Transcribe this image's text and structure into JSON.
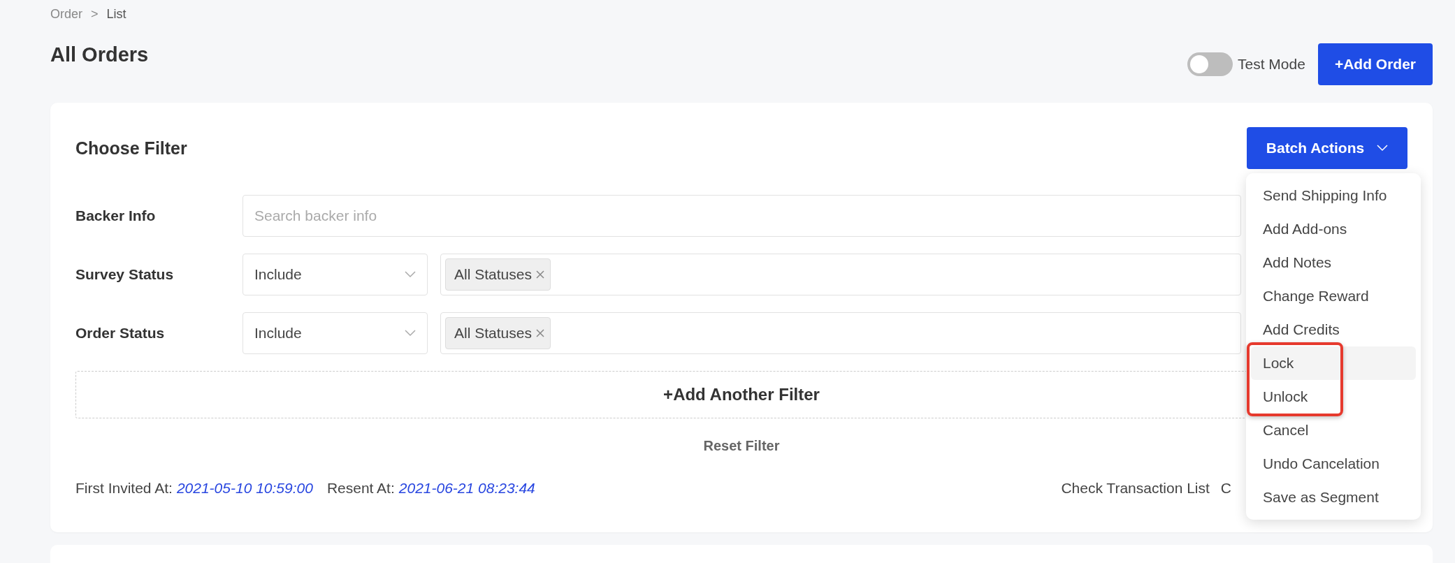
{
  "breadcrumb": {
    "items": [
      "Order",
      "List"
    ],
    "separator": ">"
  },
  "page_title": "All Orders",
  "test_mode": {
    "label": "Test Mode",
    "on": false
  },
  "add_order_button": "+Add Order",
  "filter_card": {
    "title": "Choose Filter",
    "batch_button": "Batch Actions",
    "filters": [
      {
        "kind": "search",
        "label": "Backer Info",
        "placeholder": "Search backer info"
      },
      {
        "kind": "status",
        "label": "Survey Status",
        "mode": "Include",
        "tags": [
          "All Statuses"
        ]
      },
      {
        "kind": "status",
        "label": "Order Status",
        "mode": "Include",
        "tags": [
          "All Statuses"
        ]
      }
    ],
    "add_filter": "+Add Another Filter",
    "reset": "Reset Filter",
    "dates": [
      {
        "label": "First Invited At:",
        "value": "2021-05-10 10:59:00"
      },
      {
        "label": "Resent At:",
        "value": "2021-06-21 08:23:44"
      }
    ],
    "links": [
      "Check Transaction List",
      "C"
    ]
  },
  "batch_menu": {
    "items": [
      {
        "label": "Send Shipping Info",
        "hovered": false,
        "annotated": false
      },
      {
        "label": "Add Add-ons",
        "hovered": false,
        "annotated": false
      },
      {
        "label": "Add Notes",
        "hovered": false,
        "annotated": false
      },
      {
        "label": "Change Reward",
        "hovered": false,
        "annotated": false
      },
      {
        "label": "Add Credits",
        "hovered": false,
        "annotated": false
      },
      {
        "label": "Lock",
        "hovered": true,
        "annotated": true
      },
      {
        "label": "Unlock",
        "hovered": false,
        "annotated": true
      },
      {
        "label": "Cancel",
        "hovered": false,
        "annotated": false
      },
      {
        "label": "Undo Cancelation",
        "hovered": false,
        "annotated": false
      },
      {
        "label": "Save as Segment",
        "hovered": false,
        "annotated": false
      }
    ]
  }
}
